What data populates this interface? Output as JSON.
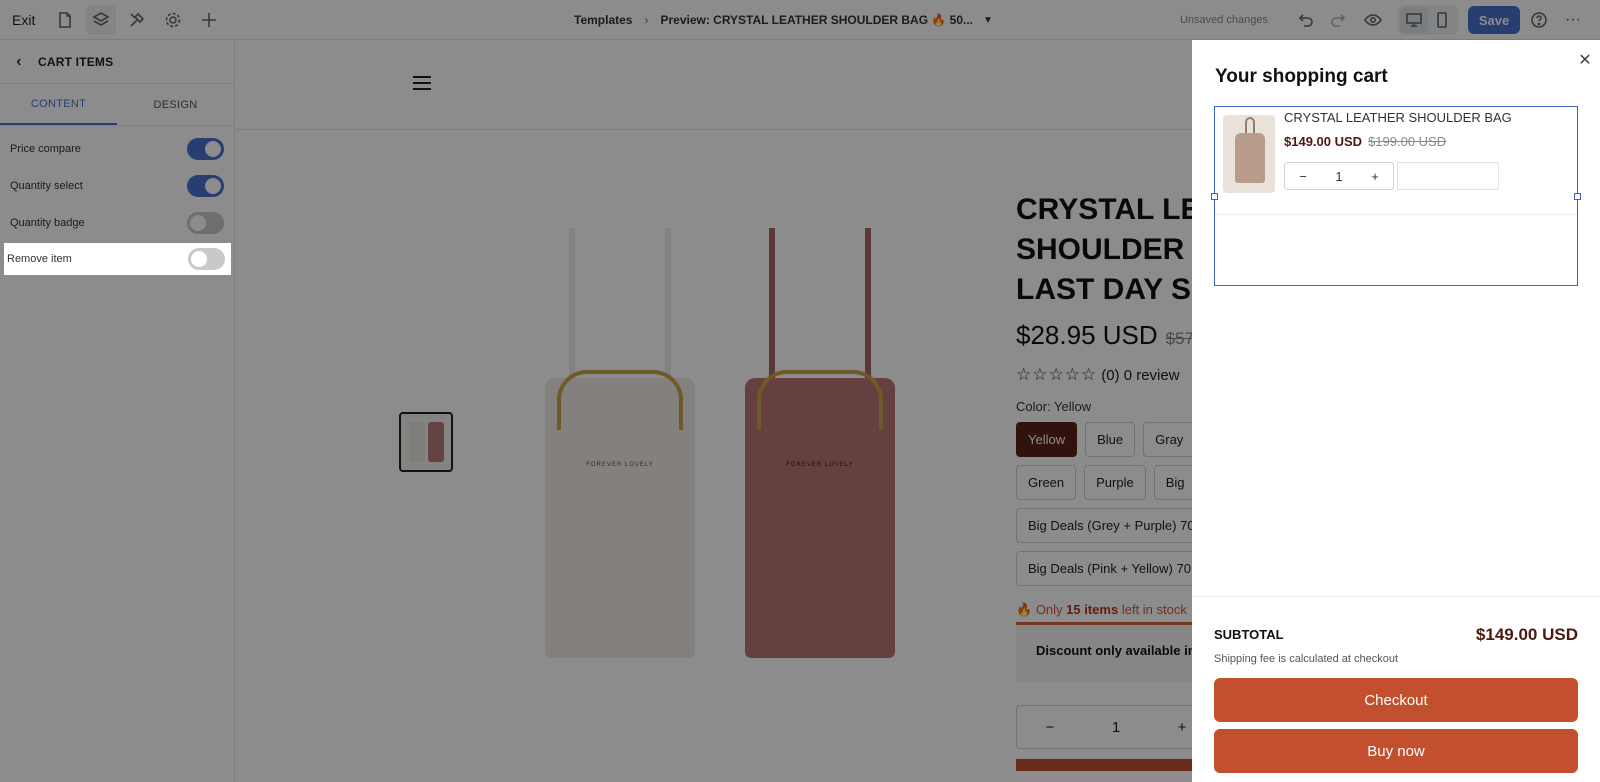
{
  "topbar": {
    "exit_label": "Exit",
    "breadcrumb_root": "Templates",
    "breadcrumb_sep": "›",
    "breadcrumb_current": "Preview: CRYSTAL LEATHER SHOULDER BAG 🔥 50...",
    "breadcrumb_caret": "▼",
    "status": "Unsaved changes",
    "save_label": "Save",
    "more_label": "···",
    "help_label": "?"
  },
  "sidebar": {
    "back_glyph": "‹",
    "title": "CART ITEMS",
    "tabs": [
      {
        "label": "CONTENT",
        "active": true
      },
      {
        "label": "DESIGN",
        "active": false
      }
    ],
    "settings": [
      {
        "label": "Price compare",
        "enabled": true
      },
      {
        "label": "Quantity select",
        "enabled": true
      },
      {
        "label": "Quantity badge",
        "enabled": false
      },
      {
        "label": "Remove item",
        "enabled": false
      }
    ]
  },
  "product": {
    "title_lines": [
      "CRYSTAL LEA",
      "SHOULDER B",
      "LAST DAY SA"
    ],
    "price": "$28.95 USD",
    "compare_price": "$57",
    "stars": "☆☆☆☆☆",
    "rating_text": "(0) 0 review",
    "color_label": "Color: Yellow",
    "variants": [
      "Yellow",
      "Blue",
      "Gray",
      "Green",
      "Purple",
      "Big"
    ],
    "bundles": [
      "Big Deals (Grey + Purple) 70",
      "Big Deals (Pink + Yellow) 70"
    ],
    "stock_prefix": "Only",
    "stock_count": "15 items",
    "stock_suffix": "left in stock",
    "discount_text": "Discount only available in",
    "qty_minus": "−",
    "qty_value": "1",
    "qty_plus": "+",
    "bag_brand": "FOREVER LOVELY"
  },
  "cart": {
    "title": "Your shopping cart",
    "close_glyph": "✕",
    "items": [
      {
        "name": "CRYSTAL LEATHER SHOULDER BAG",
        "price": "$149.00 USD",
        "compare_price": "$199.00 USD",
        "qty_minus": "−",
        "qty": "1",
        "qty_plus": "+"
      }
    ],
    "subtotal_label": "SUBTOTAL",
    "subtotal_value": "$149.00 USD",
    "shipping_note": "Shipping fee is calculated at checkout",
    "checkout_label": "Checkout",
    "buy_now_label": "Buy now"
  },
  "colors": {
    "accent": "#4a6fd0",
    "brand": "#c2502f",
    "selected_variant": "#5a2116"
  }
}
